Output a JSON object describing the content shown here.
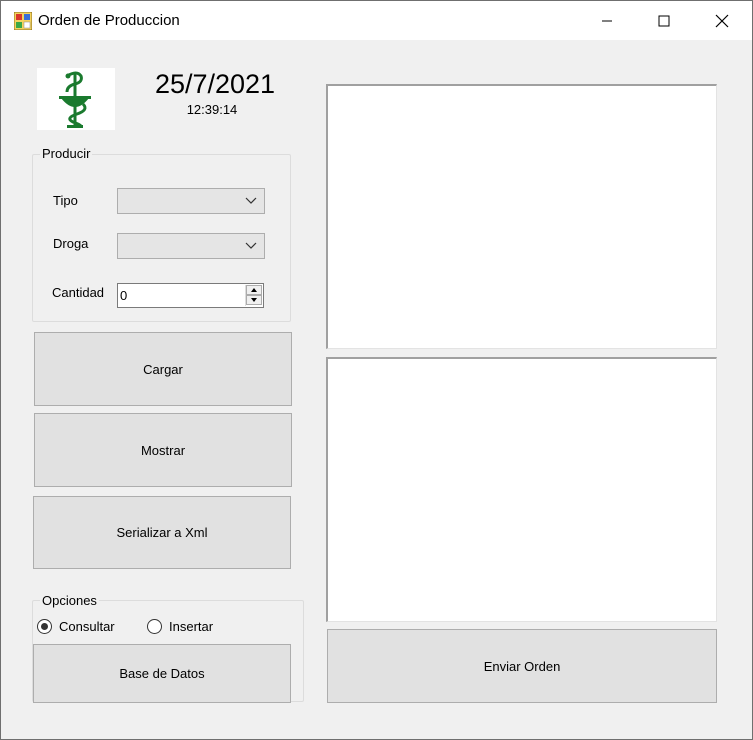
{
  "window": {
    "title": "Orden de Produccion",
    "icons": {
      "app": "form-app-icon",
      "minimize": "minimize-icon",
      "maximize": "maximize-icon",
      "close": "close-icon"
    }
  },
  "header": {
    "logo": "pharmacy-caduceus-logo",
    "date": "25/7/2021",
    "time": "12:39:14"
  },
  "producir": {
    "title": "Producir",
    "tipo_label": "Tipo",
    "tipo_value": "",
    "droga_label": "Droga",
    "droga_value": "",
    "cantidad_label": "Cantidad",
    "cantidad_value": "0"
  },
  "buttons": {
    "cargar": "Cargar",
    "mostrar": "Mostrar",
    "serializar": "Serializar a Xml",
    "base_datos": "Base de Datos",
    "enviar": "Enviar Orden"
  },
  "opciones": {
    "title": "Opciones",
    "consultar": "Consultar",
    "insertar": "Insertar",
    "selected": "consultar"
  },
  "colors": {
    "logo_green": "#1a7a2e",
    "background": "#f0f0f0",
    "button": "#e1e1e1"
  }
}
